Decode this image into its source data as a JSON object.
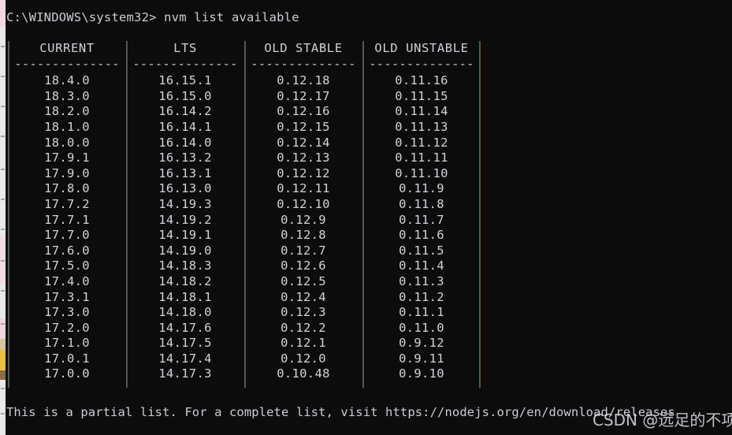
{
  "terminal": {
    "prompt": "C:\\WINDOWS\\system32> nvm list available",
    "footer": "This is a partial list. For a complete list, visit https://nodejs.org/en/download/releases",
    "background_color": "#0c0c0c",
    "text_color": "#ccccd6",
    "rule": "--------------",
    "watermark": "CSDN @远足的不项"
  },
  "table": {
    "columns": [
      {
        "header": "CURRENT",
        "values": [
          "18.4.0",
          "18.3.0",
          "18.2.0",
          "18.1.0",
          "18.0.0",
          "17.9.1",
          "17.9.0",
          "17.8.0",
          "17.7.2",
          "17.7.1",
          "17.7.0",
          "17.6.0",
          "17.5.0",
          "17.4.0",
          "17.3.1",
          "17.3.0",
          "17.2.0",
          "17.1.0",
          "17.0.1",
          "17.0.0"
        ]
      },
      {
        "header": "LTS",
        "values": [
          "16.15.1",
          "16.15.0",
          "16.14.2",
          "16.14.1",
          "16.14.0",
          "16.13.2",
          "16.13.1",
          "16.13.0",
          "14.19.3",
          "14.19.2",
          "14.19.1",
          "14.19.0",
          "14.18.3",
          "14.18.2",
          "14.18.1",
          "14.18.0",
          "14.17.6",
          "14.17.5",
          "14.17.4",
          "14.17.3"
        ]
      },
      {
        "header": "OLD STABLE",
        "values": [
          "0.12.18",
          "0.12.17",
          "0.12.16",
          "0.12.15",
          "0.12.14",
          "0.12.13",
          "0.12.12",
          "0.12.11",
          "0.12.10",
          "0.12.9",
          "0.12.8",
          "0.12.7",
          "0.12.6",
          "0.12.5",
          "0.12.4",
          "0.12.3",
          "0.12.2",
          "0.12.1",
          "0.12.0",
          "0.10.48"
        ]
      },
      {
        "header": "OLD UNSTABLE",
        "values": [
          "0.11.16",
          "0.11.15",
          "0.11.14",
          "0.11.13",
          "0.11.12",
          "0.11.11",
          "0.11.10",
          "0.11.9",
          "0.11.8",
          "0.11.7",
          "0.11.6",
          "0.11.5",
          "0.11.4",
          "0.11.3",
          "0.11.2",
          "0.11.1",
          "0.11.0",
          "0.9.12",
          "0.9.11",
          "0.9.10"
        ]
      }
    ]
  }
}
